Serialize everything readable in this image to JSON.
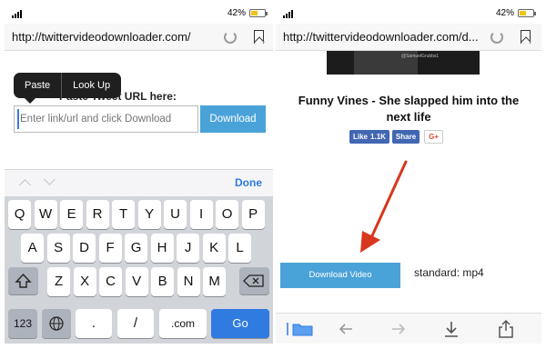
{
  "left": {
    "status": {
      "battery_pct": "42%",
      "battery_level": 0.42,
      "battery_color": "#f1c40f"
    },
    "address": {
      "url": "http://twittervideodownloader.com/"
    },
    "page": {
      "label": "Paste Tweet URL here:"
    },
    "context_menu": {
      "items": [
        "Paste",
        "Look Up"
      ]
    },
    "input": {
      "placeholder": "Enter link/url and click Download",
      "value": ""
    },
    "download_button": "Download",
    "accessory": {
      "done": "Done"
    },
    "keyboard": {
      "row1": [
        "Q",
        "W",
        "E",
        "R",
        "T",
        "Y",
        "U",
        "I",
        "O",
        "P"
      ],
      "row2": [
        "A",
        "S",
        "D",
        "F",
        "G",
        "H",
        "J",
        "K",
        "L"
      ],
      "row3": [
        "Z",
        "X",
        "C",
        "V",
        "B",
        "N",
        "M"
      ],
      "bottom": {
        "numbers": "123",
        "period": ".",
        "slash": "/",
        "dotcom": ".com",
        "go": "Go"
      }
    }
  },
  "right": {
    "status": {
      "battery_pct": "42%",
      "battery_level": 0.42,
      "battery_color": "#f1c40f"
    },
    "address": {
      "url": "http://twittervideodownloader.com/d..."
    },
    "thumb_caption": "@SamuelGrubbs1",
    "video": {
      "title": "Funny Vines - She slapped him into the next life"
    },
    "social": {
      "like": "Like",
      "like_count": "1.1K",
      "share": "Share",
      "gplus": "G+"
    },
    "download_video_button": "Download Video",
    "format": "standard: mp4",
    "accent_color": "#4aa3d8",
    "arrow_color": "#d9361e"
  }
}
